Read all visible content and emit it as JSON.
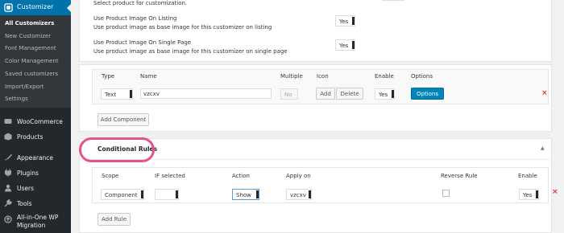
{
  "sidebar": {
    "active_label": "Customizer",
    "submenu": [
      {
        "label": "All Customizers",
        "current": true
      },
      {
        "label": "New Customizer"
      },
      {
        "label": "Font Management"
      },
      {
        "label": "Color Management"
      },
      {
        "label": "Saved customizers"
      },
      {
        "label": "Import/Export"
      },
      {
        "label": "Settings"
      }
    ],
    "menu": [
      {
        "label": "WooCommerce",
        "icon": "woocommerce-icon"
      },
      {
        "label": "Products",
        "icon": "products-icon"
      },
      {
        "label": "Appearance",
        "icon": "appearance-icon"
      },
      {
        "label": "Plugins",
        "icon": "plugins-icon"
      },
      {
        "label": "Users",
        "icon": "users-icon"
      },
      {
        "label": "Tools",
        "icon": "tools-icon"
      },
      {
        "label": "All-in-One WP",
        "label2": "Migration",
        "icon": "migration-icon"
      }
    ]
  },
  "settings": {
    "select_product_hint": "Select product for customization.",
    "listing": {
      "label": "Use Product Image On Listing",
      "desc": "Use product image as base image for this customizer on listing",
      "value": "Yes"
    },
    "single": {
      "label": "Use Product Image On Single Page",
      "desc": "Use product image as base image for this customizer on single page",
      "value": "Yes"
    }
  },
  "components": {
    "headers": [
      "Type",
      "Name",
      "Multiple",
      "Icon",
      "Enable",
      "Options"
    ],
    "row": {
      "type": "Text",
      "name": "vzcxv",
      "multiple": "No",
      "icon_add": "Add",
      "icon_delete": "Delete",
      "enable": "Yes",
      "options": "Options",
      "remove": "×"
    },
    "add_button": "Add Component"
  },
  "rules": {
    "title": "Conditional Rules",
    "toggle": "▲",
    "headers": [
      "Scope",
      "IF selected",
      "Action",
      "Apply on",
      "Reverse Rule",
      "Enable"
    ],
    "row": {
      "scope": "Component",
      "if_selected": "",
      "action": "Show",
      "apply_on": "vzcxv",
      "enable": "Yes",
      "remove": "×"
    },
    "add_button": "Add Rule"
  },
  "colors": {
    "accent": "#0073aa",
    "primary_button": "#0085ba",
    "highlight": "#e8518b",
    "remove": "#dc3232"
  }
}
